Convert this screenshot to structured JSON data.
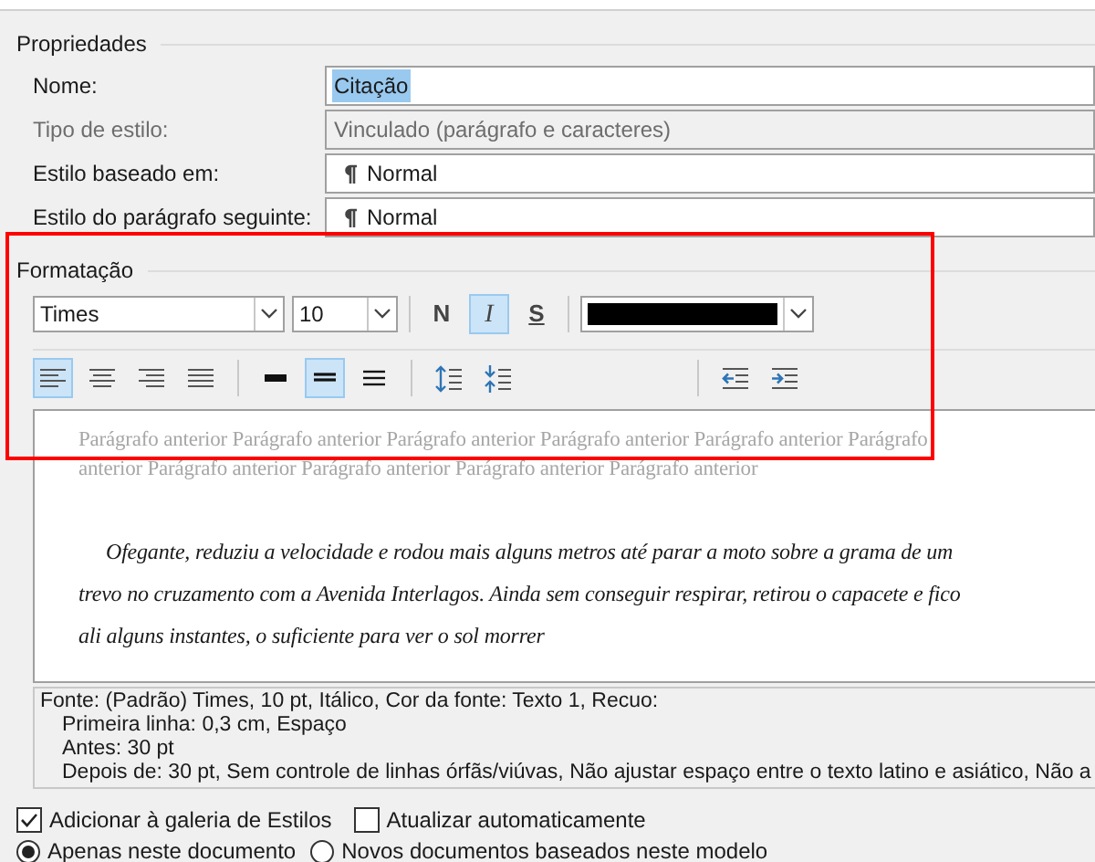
{
  "properties": {
    "title": "Propriedades",
    "fields": [
      {
        "label": "Nome:",
        "value": "Citação",
        "kind": "text",
        "disabled": false,
        "selected_text": true
      },
      {
        "label": "Tipo de estilo:",
        "value": "Vinculado (parágrafo e caracteres)",
        "kind": "text",
        "disabled": true,
        "selected_text": false
      },
      {
        "label": "Estilo baseado em:",
        "value": "Normal",
        "kind": "style",
        "disabled": false,
        "selected_text": false
      },
      {
        "label": "Estilo do parágrafo seguinte:",
        "value": "Normal",
        "kind": "style",
        "disabled": false,
        "selected_text": false
      }
    ]
  },
  "formatting": {
    "title": "Formatação",
    "font": "Times",
    "size": "10",
    "font_buttons": [
      {
        "label": "N",
        "kind": "bold",
        "selected": false
      },
      {
        "label": "I",
        "kind": "italic",
        "selected": true
      },
      {
        "label": "S",
        "kind": "underline",
        "selected": false
      }
    ],
    "color": "#000000",
    "alignment": [
      {
        "kind": "left",
        "selected": true
      },
      {
        "kind": "center",
        "selected": false
      },
      {
        "kind": "right",
        "selected": false
      },
      {
        "kind": "justify",
        "selected": false
      }
    ],
    "line_spacing": [
      {
        "kind": "single",
        "selected": false
      },
      {
        "kind": "one-half",
        "selected": true
      },
      {
        "kind": "double",
        "selected": false
      }
    ],
    "preview": {
      "previous_lines": [
        "Parágrafo anterior Parágrafo anterior Parágrafo anterior Parágrafo anterior Parágrafo anterior Parágrafo",
        "anterior Parágrafo anterior Parágrafo anterior Parágrafo anterior Parágrafo anterior"
      ],
      "sample_lines": [
        "Ofegante, reduziu a velocidade e rodou mais alguns metros até parar a moto sobre a grama de um",
        "trevo no cruzamento com a Avenida Interlagos. Ainda sem conseguir respirar, retirou o capacete e fico",
        "ali alguns instantes, o suficiente para ver o sol morrer"
      ]
    },
    "description": [
      "Fonte: (Padrão) Times, 10 pt, Itálico, Cor da fonte: Texto 1, Recuo:",
      "Primeira linha:  0,3 cm, Espaço",
      "Antes:  30 pt",
      "Depois de:  30 pt, Sem controle de linhas órfãs/viúvas, Não ajustar espaço entre o texto latino e asiático, Não a"
    ]
  },
  "options": [
    {
      "label": "Adicionar à galeria de Estilos",
      "checked": true
    },
    {
      "label": "Atualizar automaticamente",
      "checked": false
    }
  ],
  "scope": [
    {
      "label": "Apenas neste documento",
      "selected": true
    },
    {
      "label": "Novos documentos baseados neste modelo",
      "selected": false
    }
  ]
}
